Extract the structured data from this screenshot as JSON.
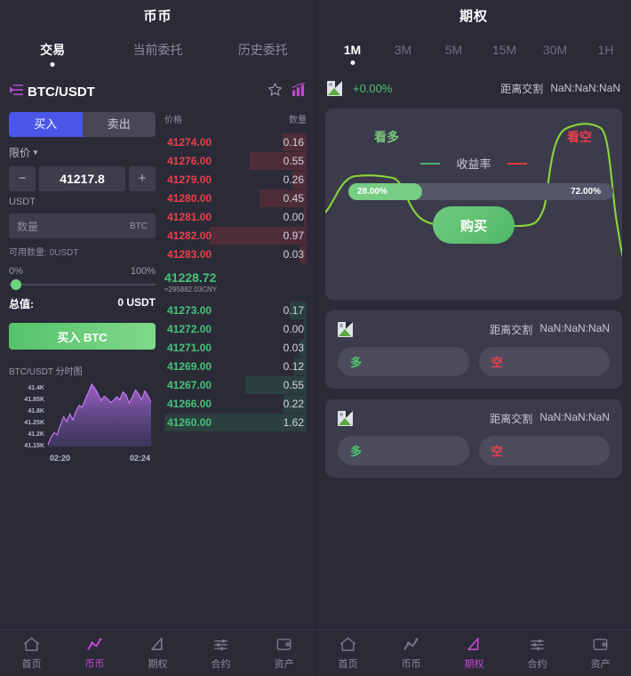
{
  "left": {
    "title": "币币",
    "tabs": [
      {
        "label": "交易",
        "active": true
      },
      {
        "label": "当前委托",
        "active": false
      },
      {
        "label": "历史委托",
        "active": false
      }
    ],
    "pair": {
      "name": "BTC/USDT",
      "menu_icon": "list-arrow-icon",
      "favorite_icon": "star-icon",
      "chart_icon": "bar-chart-icon"
    },
    "form": {
      "buy_label": "买入",
      "sell_label": "卖出",
      "order_type": "限价",
      "minus_label": "−",
      "plus_label": "+",
      "price_value": "41217.8",
      "price_unit": "USDT",
      "amount_placeholder": "数量",
      "amount_unit": "BTC",
      "available_label": "可用数量:",
      "available_value": "0USDT",
      "pct_min": "0%",
      "pct_max": "100%",
      "total_label": "总值:",
      "total_value": "0 USDT",
      "submit_label": "买入 BTC"
    },
    "minichart": {
      "title": "BTC/USDT 分时图",
      "y_ticks": [
        "41.4K",
        "41.85K",
        "41.8K",
        "41.25K",
        "41.2K",
        "41.15K"
      ],
      "x_ticks": [
        "02:20",
        "02:24"
      ]
    },
    "orderbook": {
      "col_price": "价格",
      "col_amount": "数量",
      "asks": [
        {
          "price": "41274.00",
          "amount": "0.16",
          "depth": 17
        },
        {
          "price": "41276.00",
          "amount": "0.55",
          "depth": 40
        },
        {
          "price": "41279.00",
          "amount": "0.26",
          "depth": 10
        },
        {
          "price": "41280.00",
          "amount": "0.45",
          "depth": 33
        },
        {
          "price": "41281.00",
          "amount": "0.00",
          "depth": 2
        },
        {
          "price": "41282.00",
          "amount": "0.97",
          "depth": 68
        },
        {
          "price": "41283.00",
          "amount": "0.03",
          "depth": 5
        }
      ],
      "last_price": "41228.72",
      "last_cny": "≈295882.03CNY",
      "bids": [
        {
          "price": "41273.00",
          "amount": "0.17",
          "depth": 12
        },
        {
          "price": "41272.00",
          "amount": "0.00",
          "depth": 2
        },
        {
          "price": "41271.00",
          "amount": "0.03",
          "depth": 5
        },
        {
          "price": "41269.00",
          "amount": "0.12",
          "depth": 9
        },
        {
          "price": "41267.00",
          "amount": "0.55",
          "depth": 43
        },
        {
          "price": "41266.00",
          "amount": "0.22",
          "depth": 16
        },
        {
          "price": "41260.00",
          "amount": "1.62",
          "depth": 100
        }
      ]
    },
    "nav": [
      {
        "label": "首页",
        "icon": "home-icon",
        "active": false
      },
      {
        "label": "币币",
        "icon": "zigzag-icon",
        "active": true
      },
      {
        "label": "期权",
        "icon": "triangle-icon",
        "active": false
      },
      {
        "label": "合约",
        "icon": "sliders-icon",
        "active": false
      },
      {
        "label": "资产",
        "icon": "wallet-icon",
        "active": false
      }
    ]
  },
  "right": {
    "title": "期权",
    "periods": [
      {
        "label": "1M",
        "active": true
      },
      {
        "label": "3M",
        "active": false
      },
      {
        "label": "5M",
        "active": false
      },
      {
        "label": "15M",
        "active": false
      },
      {
        "label": "30M",
        "active": false
      },
      {
        "label": "1H",
        "active": false
      }
    ],
    "header": {
      "logo_icon": "broken-image-icon",
      "change_pct": "+0.00%",
      "settle_label": "距离交割",
      "settle_value": "NaN:NaN:NaN"
    },
    "main_card": {
      "long_label": "看多",
      "short_label": "看空",
      "legend_label": "收益率",
      "legend_long_color": "#4fae66",
      "legend_short_color": "#e03b3b",
      "ratio_left": "28.00%",
      "ratio_right": "72.00%",
      "ratio_fill_pct": 28,
      "buy_label": "购买"
    },
    "sub_cards": [
      {
        "logo_icon": "broken-image-icon",
        "settle_label": "距离交割",
        "settle_value": "NaN:NaN:NaN",
        "long_label": "多",
        "short_label": "空"
      },
      {
        "logo_icon": "broken-image-icon",
        "settle_label": "距离交割",
        "settle_value": "NaN:NaN:NaN",
        "long_label": "多",
        "short_label": "空"
      }
    ],
    "nav": [
      {
        "label": "首页",
        "icon": "home-icon",
        "active": false
      },
      {
        "label": "币币",
        "icon": "zigzag-icon",
        "active": false
      },
      {
        "label": "期权",
        "icon": "triangle-icon",
        "active": true
      },
      {
        "label": "合约",
        "icon": "sliders-icon",
        "active": false
      },
      {
        "label": "资产",
        "icon": "wallet-icon",
        "active": false
      }
    ]
  },
  "chart_data": {
    "type": "line",
    "title": "BTC/USDT 分时图",
    "xlabel": "",
    "ylabel": "",
    "x_tick_labels": [
      "02:20",
      "02:24"
    ],
    "y_tick_labels": [
      "41.4K",
      "41.85K",
      "41.8K",
      "41.25K",
      "41.2K",
      "41.15K"
    ],
    "series": [
      {
        "name": "BTC/USDT",
        "values": [
          41180,
          41196,
          41205,
          41201,
          41222,
          41238,
          41228,
          41244,
          41232,
          41250,
          41262,
          41258,
          41276,
          41290,
          41306,
          41298,
          41286,
          41272,
          41281,
          41276,
          41268,
          41272,
          41280,
          41274,
          41290,
          41284,
          41266,
          41280,
          41294,
          41286,
          41274,
          41292,
          41282,
          41268
        ]
      }
    ],
    "grid": false,
    "legend": "none"
  }
}
